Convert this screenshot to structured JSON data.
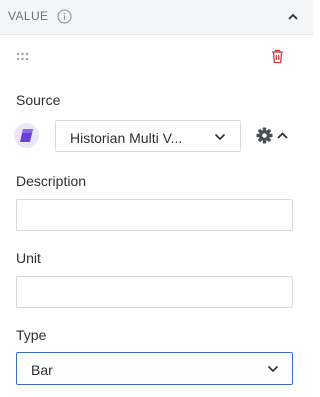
{
  "panel": {
    "title": "VALUE",
    "icons": {
      "info": "info-icon",
      "collapse": "chevron-up-icon",
      "drag": "drag-handle-icon",
      "delete": "trash-icon"
    }
  },
  "source": {
    "label": "Source",
    "icon": "data-source-icon",
    "selected": "Historian Multi V...",
    "icons": {
      "settings": "gear-icon",
      "toggle": "caret-up-icon"
    }
  },
  "description": {
    "label": "Description",
    "value": ""
  },
  "unit": {
    "label": "Unit",
    "value": ""
  },
  "type": {
    "label": "Type",
    "selected": "Bar"
  },
  "colors": {
    "accent": "#3a6fc7",
    "delete": "#d9363e",
    "source_icon": "#6a3fd8"
  }
}
